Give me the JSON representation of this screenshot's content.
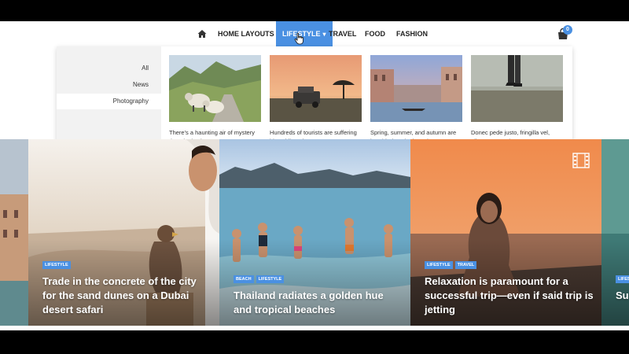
{
  "nav": {
    "home_icon": "home-icon",
    "items": [
      {
        "label": "HOME LAYOUTS",
        "has_dropdown": true
      },
      {
        "label": "LIFESTYLE",
        "has_dropdown": true,
        "active": true
      },
      {
        "label": "TRAVEL",
        "has_dropdown": false
      },
      {
        "label": "FOOD",
        "has_dropdown": false
      },
      {
        "label": "FASHION",
        "has_dropdown": false
      }
    ],
    "cart_icon": "shopping-bag-icon",
    "cart_count": "0",
    "accent_color": "#4a90e2"
  },
  "mega_menu": {
    "categories": [
      {
        "label": "All",
        "active": false
      },
      {
        "label": "News",
        "active": false
      },
      {
        "label": "Photography",
        "active": true
      }
    ],
    "posts": [
      {
        "excerpt": "There's a haunting air of mystery that cloaks the..."
      },
      {
        "excerpt": "Hundreds of tourists are suffering bite while trying to..."
      },
      {
        "excerpt": "Spring, summer, and autumn are heralded as the best tim..."
      },
      {
        "excerpt": "Donec pede justo, fringilla vel, aliquet nec, vulputate..."
      }
    ]
  },
  "slider": {
    "slides": [
      {
        "tags": [],
        "title": ""
      },
      {
        "tags": [
          "LIFESTYLE"
        ],
        "title": "Trade in the concrete of the city for the sand dunes on a Dubai desert safari"
      },
      {
        "tags": [
          "BEACH",
          "LIFESTYLE"
        ],
        "title": "Thailand radiates a golden hue and tropical beaches"
      },
      {
        "tags": [
          "LIFESTYLE",
          "TRAVEL"
        ],
        "title": "Relaxation is paramount for a successful trip—even if said trip is jetting"
      },
      {
        "tags": [
          "LIFESTYLE"
        ],
        "title": "Su Bu"
      }
    ],
    "video_icon": "film-icon"
  }
}
